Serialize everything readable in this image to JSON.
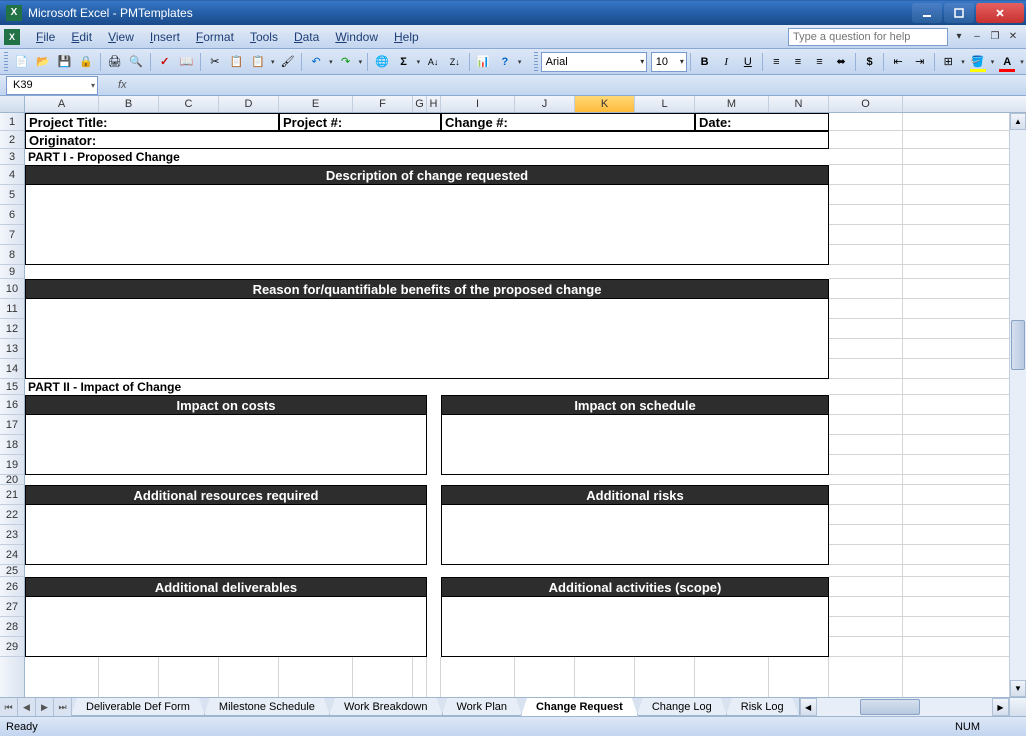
{
  "titlebar": {
    "text": "Microsoft Excel - PMTemplates"
  },
  "menu": {
    "items": [
      "File",
      "Edit",
      "View",
      "Insert",
      "Format",
      "Tools",
      "Data",
      "Window",
      "Help"
    ],
    "help_placeholder": "Type a question for help"
  },
  "toolbar": {
    "font_name": "Arial",
    "font_size": "10"
  },
  "namebox": {
    "ref": "K39"
  },
  "columns": [
    {
      "l": "A",
      "w": 74
    },
    {
      "l": "B",
      "w": 60
    },
    {
      "l": "C",
      "w": 60
    },
    {
      "l": "D",
      "w": 60
    },
    {
      "l": "E",
      "w": 74
    },
    {
      "l": "F",
      "w": 60
    },
    {
      "l": "G",
      "w": 14
    },
    {
      "l": "H",
      "w": 14
    },
    {
      "l": "I",
      "w": 74
    },
    {
      "l": "J",
      "w": 60
    },
    {
      "l": "K",
      "w": 60
    },
    {
      "l": "L",
      "w": 60
    },
    {
      "l": "M",
      "w": 74
    },
    {
      "l": "N",
      "w": 60
    },
    {
      "l": "O",
      "w": 74
    }
  ],
  "rows": [
    {
      "n": 1,
      "h": 18
    },
    {
      "n": 2,
      "h": 18
    },
    {
      "n": 3,
      "h": 16
    },
    {
      "n": 4,
      "h": 20
    },
    {
      "n": 5,
      "h": 20
    },
    {
      "n": 6,
      "h": 20
    },
    {
      "n": 7,
      "h": 20
    },
    {
      "n": 8,
      "h": 20
    },
    {
      "n": 9,
      "h": 14
    },
    {
      "n": 10,
      "h": 20
    },
    {
      "n": 11,
      "h": 20
    },
    {
      "n": 12,
      "h": 20
    },
    {
      "n": 13,
      "h": 20
    },
    {
      "n": 14,
      "h": 20
    },
    {
      "n": 15,
      "h": 16
    },
    {
      "n": 16,
      "h": 20
    },
    {
      "n": 17,
      "h": 20
    },
    {
      "n": 18,
      "h": 20
    },
    {
      "n": 19,
      "h": 20
    },
    {
      "n": 20,
      "h": 10
    },
    {
      "n": 21,
      "h": 20
    },
    {
      "n": 22,
      "h": 20
    },
    {
      "n": 23,
      "h": 20
    },
    {
      "n": 24,
      "h": 20
    },
    {
      "n": 25,
      "h": 12
    },
    {
      "n": 26,
      "h": 20
    },
    {
      "n": 27,
      "h": 20
    },
    {
      "n": 28,
      "h": 20
    },
    {
      "n": 29,
      "h": 20
    }
  ],
  "selected_col": "K",
  "sheet": {
    "row1": {
      "project_title": "Project Title:",
      "project_num": "Project #:",
      "change_num": "Change #:",
      "date": "Date:"
    },
    "row2": {
      "originator": "Originator:"
    },
    "row3": "PART I - Proposed Change",
    "row4": "Description of change requested",
    "row10": "Reason for/quantifiable benefits of the proposed change",
    "row15": "PART II - Impact of Change",
    "row16_l": "Impact on costs",
    "row16_r": "Impact on schedule",
    "row21_l": "Additional resources required",
    "row21_r": "Additional risks",
    "row26_l": "Additional deliverables",
    "row26_r": "Additional activities (scope)"
  },
  "tabs": {
    "list": [
      "Deliverable Def Form",
      "Milestone Schedule",
      "Work Breakdown",
      "Work Plan",
      "Change Request",
      "Change Log",
      "Risk Log"
    ],
    "active": "Change Request"
  },
  "status": {
    "left": "Ready",
    "num": "NUM"
  }
}
